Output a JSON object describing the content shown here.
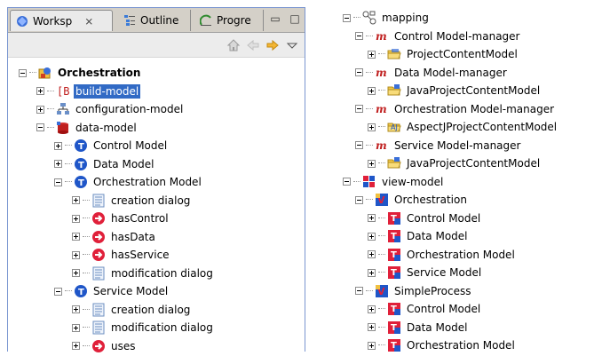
{
  "left_view": {
    "tabs": [
      {
        "label": "Worksp",
        "close": "⨯"
      },
      {
        "label": "Outline"
      },
      {
        "label": "Progre"
      }
    ],
    "tree": [
      {
        "label": "Orchestration",
        "indent": 0,
        "expander": "minus",
        "icon": "project-icon",
        "bold": true
      },
      {
        "label": "build-model",
        "indent": 1,
        "expander": "plus",
        "icon": "bracket-b-icon",
        "selected": true
      },
      {
        "label": "configuration-model",
        "indent": 1,
        "expander": "plus",
        "icon": "network-icon"
      },
      {
        "label": "data-model",
        "indent": 1,
        "expander": "minus",
        "icon": "datamodel-icon"
      },
      {
        "label": "Control Model",
        "indent": 2,
        "expander": "plus",
        "icon": "type-t-icon"
      },
      {
        "label": "Data Model",
        "indent": 2,
        "expander": "plus",
        "icon": "type-t-icon"
      },
      {
        "label": "Orchestration Model",
        "indent": 2,
        "expander": "minus",
        "icon": "type-t-icon"
      },
      {
        "label": "creation dialog",
        "indent": 3,
        "expander": "plus",
        "icon": "form-icon"
      },
      {
        "label": "hasControl",
        "indent": 3,
        "expander": "plus",
        "icon": "arrow-right-icon"
      },
      {
        "label": "hasData",
        "indent": 3,
        "expander": "plus",
        "icon": "arrow-right-icon"
      },
      {
        "label": "hasService",
        "indent": 3,
        "expander": "plus",
        "icon": "arrow-right-icon"
      },
      {
        "label": "modification dialog",
        "indent": 3,
        "expander": "plus",
        "icon": "form-icon"
      },
      {
        "label": "Service Model",
        "indent": 2,
        "expander": "minus",
        "icon": "type-t-icon"
      },
      {
        "label": "creation dialog",
        "indent": 3,
        "expander": "plus",
        "icon": "form-icon"
      },
      {
        "label": "modification dialog",
        "indent": 3,
        "expander": "plus",
        "icon": "form-icon"
      },
      {
        "label": "uses",
        "indent": 3,
        "expander": "plus",
        "icon": "arrow-right-icon"
      }
    ]
  },
  "right_tree": [
    {
      "label": "mapping",
      "indent": 0,
      "expander": "minus",
      "icon": "mapping-icon"
    },
    {
      "label": "Control Model-manager",
      "indent": 1,
      "expander": "minus",
      "icon": "manager-m-icon"
    },
    {
      "label": "ProjectContentModel",
      "indent": 2,
      "expander": "plus",
      "icon": "folder-icon"
    },
    {
      "label": "Data Model-manager",
      "indent": 1,
      "expander": "minus",
      "icon": "manager-m-icon"
    },
    {
      "label": "JavaProjectContentModel",
      "indent": 2,
      "expander": "plus",
      "icon": "java-folder-icon"
    },
    {
      "label": "Orchestration Model-manager",
      "indent": 1,
      "expander": "minus",
      "icon": "manager-m-icon"
    },
    {
      "label": "AspectJProjectContentModel",
      "indent": 2,
      "expander": "plus",
      "icon": "aspectj-folder-icon"
    },
    {
      "label": "Service Model-manager",
      "indent": 1,
      "expander": "minus",
      "icon": "manager-m-icon"
    },
    {
      "label": "JavaProjectContentModel",
      "indent": 2,
      "expander": "plus",
      "icon": "java-folder-icon"
    },
    {
      "label": "view-model",
      "indent": 0,
      "expander": "minus",
      "icon": "viewmodel-icon"
    },
    {
      "label": "Orchestration",
      "indent": 1,
      "expander": "minus",
      "icon": "view-v-icon"
    },
    {
      "label": "Control Model",
      "indent": 2,
      "expander": "plus",
      "icon": "view-t-icon"
    },
    {
      "label": "Data Model",
      "indent": 2,
      "expander": "plus",
      "icon": "view-t-icon"
    },
    {
      "label": "Orchestration Model",
      "indent": 2,
      "expander": "plus",
      "icon": "view-t-icon"
    },
    {
      "label": "Service Model",
      "indent": 2,
      "expander": "plus",
      "icon": "view-t-icon"
    },
    {
      "label": "SimpleProcess",
      "indent": 1,
      "expander": "minus",
      "icon": "view-v-icon"
    },
    {
      "label": "Control Model",
      "indent": 2,
      "expander": "plus",
      "icon": "view-t-icon"
    },
    {
      "label": "Data Model",
      "indent": 2,
      "expander": "plus",
      "icon": "view-t-icon"
    },
    {
      "label": "Orchestration Model",
      "indent": 2,
      "expander": "plus",
      "icon": "view-t-icon"
    }
  ],
  "colors": {
    "selection": "#316ac5",
    "view_border": "#7a96d1",
    "tab_bar": "#d4d0c8"
  }
}
